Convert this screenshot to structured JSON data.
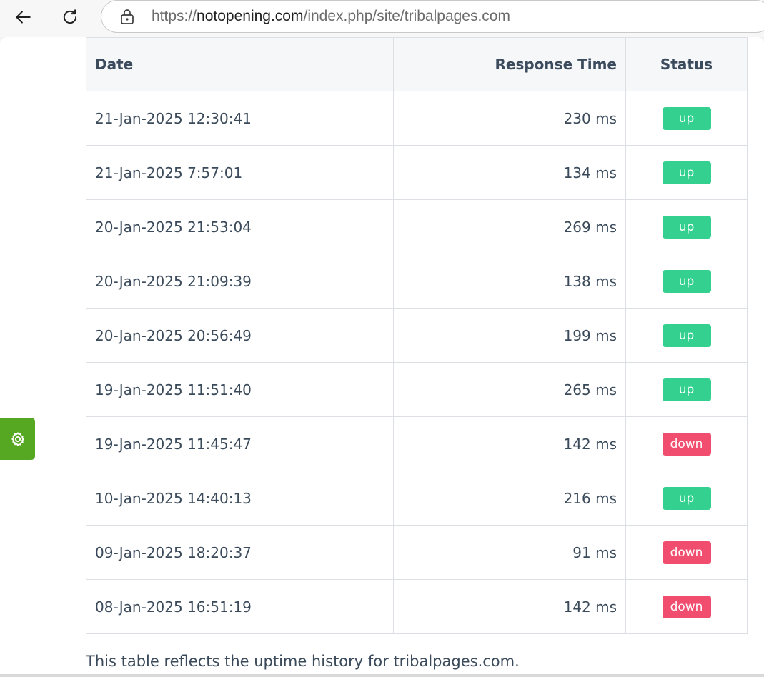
{
  "browser": {
    "url_prefix": "https://",
    "url_host": "notopening.com",
    "url_path": "/index.php/site/tribalpages.com"
  },
  "table": {
    "headers": {
      "date": "Date",
      "response_time": "Response Time",
      "status": "Status"
    },
    "rows": [
      {
        "date": "21-Jan-2025 12:30:41",
        "response_time": "230 ms",
        "status": "up"
      },
      {
        "date": "21-Jan-2025 7:57:01",
        "response_time": "134 ms",
        "status": "up"
      },
      {
        "date": "20-Jan-2025 21:53:04",
        "response_time": "269 ms",
        "status": "up"
      },
      {
        "date": "20-Jan-2025 21:09:39",
        "response_time": "138 ms",
        "status": "up"
      },
      {
        "date": "20-Jan-2025 20:56:49",
        "response_time": "199 ms",
        "status": "up"
      },
      {
        "date": "19-Jan-2025 11:51:40",
        "response_time": "265 ms",
        "status": "up"
      },
      {
        "date": "19-Jan-2025 11:45:47",
        "response_time": "142 ms",
        "status": "down"
      },
      {
        "date": "10-Jan-2025 14:40:13",
        "response_time": "216 ms",
        "status": "up"
      },
      {
        "date": "09-Jan-2025 18:20:37",
        "response_time": "91 ms",
        "status": "down"
      },
      {
        "date": "08-Jan-2025 16:51:19",
        "response_time": "142 ms",
        "status": "down"
      }
    ]
  },
  "caption": "This table reflects the uptime history for tribalpages.com.",
  "colors": {
    "up": "#33d08f",
    "down": "#f14e6f",
    "gear_tab": "#56a822"
  },
  "icons": {
    "back": "back-arrow-icon",
    "reload": "reload-icon",
    "lock": "lock-icon",
    "gear": "gear-icon"
  }
}
